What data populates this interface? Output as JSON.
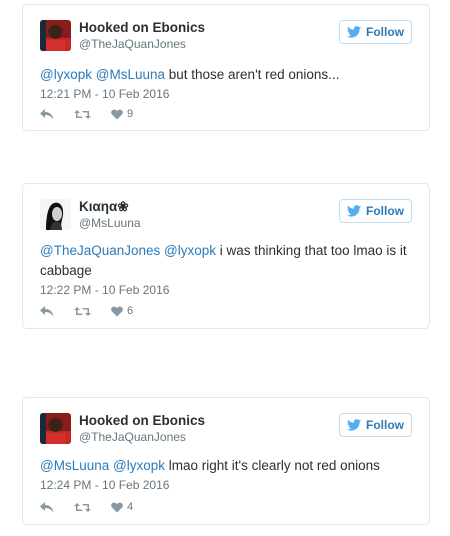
{
  "tweets": [
    {
      "name": "Hooked on Ebonics",
      "handle": "@TheJaQuanJones",
      "follow_label": "Follow",
      "text_parts": [
        {
          "mention": "@lyxopk"
        },
        {
          "text": " "
        },
        {
          "mention": "@MsLuuna"
        },
        {
          "text": " but those aren't red onions..."
        }
      ],
      "timestamp": "12:21 PM - 10 Feb 2016",
      "likes": "9"
    },
    {
      "name": "Kιαηα❀",
      "handle": "@MsLuuna",
      "follow_label": "Follow",
      "text_parts": [
        {
          "mention": "@TheJaQuanJones"
        },
        {
          "text": " "
        },
        {
          "mention": "@lyxopk"
        },
        {
          "text": " i was thinking that too lmao is it cabbage"
        }
      ],
      "timestamp": "12:22 PM - 10 Feb 2016",
      "likes": "6"
    },
    {
      "name": "Hooked on Ebonics",
      "handle": "@TheJaQuanJones",
      "follow_label": "Follow",
      "text_parts": [
        {
          "mention": "@MsLuuna"
        },
        {
          "text": " "
        },
        {
          "mention": "@lyxopk"
        },
        {
          "text": " lmao right it's clearly not red onions"
        }
      ],
      "timestamp": "12:24 PM - 10 Feb 2016",
      "likes": "4"
    }
  ],
  "colors": {
    "link": "#2b7bb9",
    "muted": "#66757f",
    "border": "#e1e8ed"
  },
  "icons": {
    "reply": "reply-icon",
    "retweet": "retweet-icon",
    "like": "heart-icon",
    "bird": "twitter-bird-icon"
  }
}
